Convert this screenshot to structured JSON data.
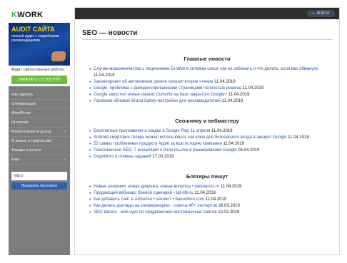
{
  "sidebar": {
    "logo_prefix": "",
    "logo_k": "K",
    "logo_rest": "WORK",
    "banner_title": "AUDIT САЙТА",
    "banner_subtitle": "полный аудит с подробными рекомендациями",
    "promo_text": "Аудит сайта главные работы",
    "promo_button": "ЗАКАЗАТЬ ОТ 500 РУБ",
    "nav_items": [
      {
        "label": "Как сделать",
        "arrow": ""
      },
      {
        "label": "Оптимизация",
        "arrow": ""
      },
      {
        "label": "WordPress",
        "arrow": ""
      },
      {
        "label": "Интернет",
        "arrow": ""
      },
      {
        "label": "Монетизация и доход",
        "arrow": "›"
      },
      {
        "label": "О жизни и творчестве",
        "arrow": ""
      },
      {
        "label": "Товары и услуги",
        "arrow": ""
      },
      {
        "label": "Еще",
        "arrow": "›"
      }
    ],
    "search_value": "http://",
    "search_button": "Проверить бесплатно"
  },
  "topbar": {
    "login_label": "ВОЙТИ",
    "login_icon": "user-icon"
  },
  "main": {
    "page_title": "SEO — новости",
    "sections": [
      {
        "title": "Главные новости",
        "items": [
          {
            "text": "Случаи мошенничества с лицензиями Dr.Web в сетевом сексе: как их избежать и что делать, если вас обманули",
            "date": "11.04.2019"
          },
          {
            "text": "Законопроект об автономном рунете прошел второе чтение",
            "date": "11.04.2019"
          },
          {
            "text": "Google: проблема с деиндексированными страницами полностью решена",
            "date": "11.04.2019"
          },
          {
            "text": "Google запустил новые сервис Currents на базе закрытого Google+",
            "date": "11.04.2019"
          },
          {
            "text": "Facebook обновил Brand Safety-настройки для рекламодателей",
            "date": "11.04.2019"
          }
        ]
      },
      {
        "title": "Сеошнику и вебмастеру",
        "items": [
          {
            "text": "Бесплатные приложения и скидки в Google Play 11 апреля",
            "date": "11.04.2019"
          },
          {
            "text": "Android-смартфон теперь можно использовать как ключ для безопасного входа в аккаунт Google",
            "date": "11.04.2019"
          },
          {
            "text": "52 самых проблемных продукта Apple за всю историю компании",
            "date": "11.04.2019"
          },
          {
            "text": "Тематическое SEO: 7 концепций о роли ссылок в ранжировании Google",
            "date": "05.04.2019"
          },
          {
            "text": "Gogetlinks и отмены заданий",
            "date": "27.03.2019"
          }
        ]
      },
      {
        "title": "Блогеры пишут",
        "items": [
          {
            "text": "Новые решения, новая девушка, новые вопросы • webnaroci.ru",
            "date": "11.04.2019"
          },
          {
            "text": "Продающий вебинар: боевой сценарий • tall-life.ru",
            "date": "11.04.2019"
          },
          {
            "text": "Как добавить сайт в AdSense • чеклист • banochkin.com",
            "date": "11.04.2019"
          },
          {
            "text": "Как делать доклады на конференциях - советы 40+ экспертов",
            "date": "28.03.2019"
          },
          {
            "text": "SEO Школа - мой курс по продвижению англоязычных сайтов",
            "date": "13.02.2019"
          }
        ]
      }
    ]
  },
  "colors": {
    "sidebar_bg": "#7d7d7d",
    "link": "#2755a8",
    "promo_button": "#6cbf3c",
    "search_button": "#2a62b8",
    "topbar": "#2d2d2d"
  }
}
